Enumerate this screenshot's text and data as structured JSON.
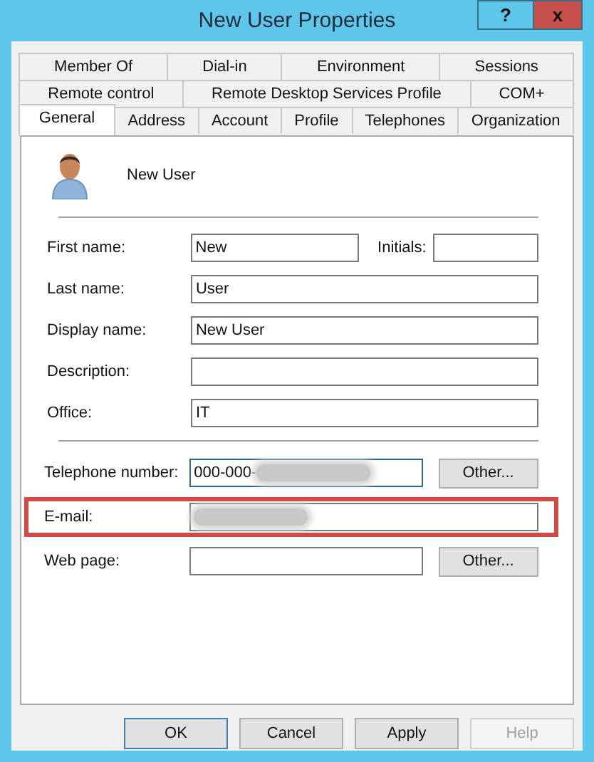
{
  "window": {
    "title": "New User Properties",
    "controls": [
      {
        "kind": "help",
        "label": "?"
      },
      {
        "kind": "close",
        "label": "x"
      }
    ]
  },
  "tab_rows": [
    [
      {
        "label": "Member Of",
        "selected": false
      },
      {
        "label": "Dial-in",
        "selected": false
      },
      {
        "label": "Environment",
        "selected": false
      },
      {
        "label": "Sessions",
        "selected": false
      }
    ],
    [
      {
        "label": "Remote control",
        "selected": false
      },
      {
        "label": "Remote Desktop Services Profile",
        "selected": false
      },
      {
        "label": "COM+",
        "selected": false
      }
    ],
    [
      {
        "label": "General",
        "selected": true
      },
      {
        "label": "Address",
        "selected": false
      },
      {
        "label": "Account",
        "selected": false
      },
      {
        "label": "Profile",
        "selected": false
      },
      {
        "label": "Telephones",
        "selected": false
      },
      {
        "label": "Organization",
        "selected": false
      }
    ]
  ],
  "user": {
    "name": "New User"
  },
  "name_fields": [
    {
      "label": "First name:",
      "value": "New",
      "side": {
        "label": "Initials:"
      }
    },
    {
      "label": "Last name:",
      "value": "User"
    },
    {
      "label": "Display name:",
      "value": "New User"
    },
    {
      "label": "Description:"
    },
    {
      "label": "Office:",
      "value": "IT"
    }
  ],
  "contact_fields": [
    {
      "label": "Telephone number:",
      "value": "000-000-",
      "blurred": true,
      "focused": true,
      "highlighted": false,
      "button": "Other..."
    },
    {
      "label": "E-mail:",
      "blurred": true,
      "focused": false,
      "highlighted": true
    },
    {
      "label": "Web page:",
      "blurred": false,
      "focused": false,
      "highlighted": false,
      "button": "Other..."
    }
  ],
  "buttons": [
    {
      "label": "OK",
      "disabled": false,
      "default": true
    },
    {
      "label": "Cancel",
      "disabled": false,
      "default": false
    },
    {
      "label": "Apply",
      "disabled": false,
      "default": false
    },
    {
      "label": "Help",
      "disabled": true,
      "default": false
    }
  ]
}
